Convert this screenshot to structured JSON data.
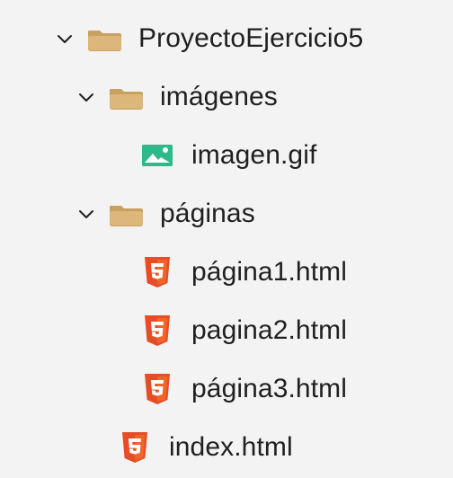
{
  "explorer": {
    "items": [
      {
        "label": "ProyectoEjercicio5",
        "type": "folder",
        "expanded": true,
        "level": 0
      },
      {
        "label": "imágenes",
        "type": "folder",
        "expanded": true,
        "level": 1
      },
      {
        "label": "imagen.gif",
        "type": "image-file",
        "level": 2
      },
      {
        "label": "páginas",
        "type": "folder",
        "expanded": true,
        "level": 1
      },
      {
        "label": "página1.html",
        "type": "html-file",
        "level": 2
      },
      {
        "label": "pagina2.html",
        "type": "html-file",
        "level": 2
      },
      {
        "label": "página3.html",
        "type": "html-file",
        "level": 2
      },
      {
        "label": "index.html",
        "type": "html-file",
        "level": 1
      }
    ]
  },
  "colors": {
    "background": "#f3f3f3",
    "text": "#202020",
    "chevron": "#1f1f1f",
    "folder": "#dcb67a",
    "folder_dark": "#c9a15f",
    "image_icon": "#2fb88a",
    "html_icon": "#e44d26",
    "html_icon_dark": "#f16529"
  },
  "icons": {
    "chevron": "chevron-down-icon",
    "folder": "folder-open-icon",
    "image": "image-file-icon",
    "html": "html5-file-icon"
  }
}
